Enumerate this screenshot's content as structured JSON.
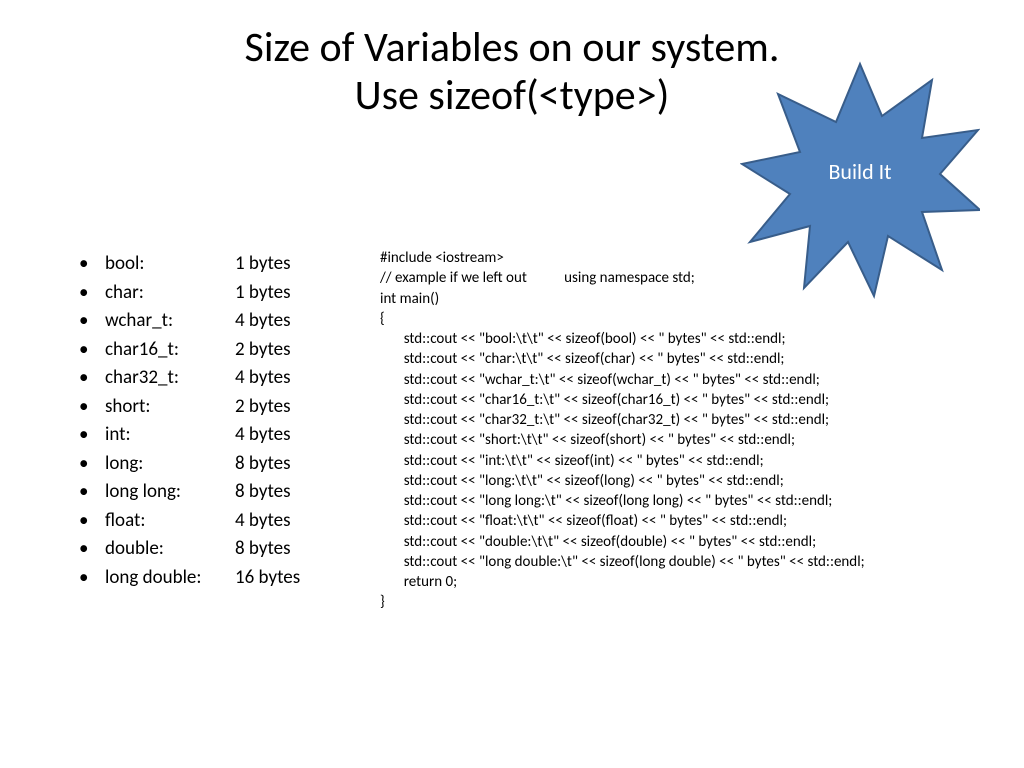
{
  "title": {
    "line1": "Size of Variables on our system.",
    "line2": "Use sizeof(<type>)"
  },
  "badge": {
    "label": "Build It",
    "fill": "#4f81bd",
    "stroke": "#385d8a"
  },
  "sizes": [
    {
      "type": "bool:",
      "value": "1 bytes"
    },
    {
      "type": "char:",
      "value": "1 bytes"
    },
    {
      "type": "wchar_t:",
      "value": "4 bytes"
    },
    {
      "type": "char16_t:",
      "value": "2 bytes"
    },
    {
      "type": "char32_t:",
      "value": "4 bytes"
    },
    {
      "type": "short:",
      "value": "2 bytes"
    },
    {
      "type": "int:",
      "value": "4 bytes"
    },
    {
      "type": "long:",
      "value": "8 bytes"
    },
    {
      "type": "long long:",
      "value": "8 bytes"
    },
    {
      "type": "float:",
      "value": "4 bytes"
    },
    {
      "type": "double:",
      "value": "8 bytes"
    },
    {
      "type": "long double:",
      "value": "16 bytes"
    }
  ],
  "code": "#include <iostream>\n// example if we left out           using namespace std;\nint main()\n{\n       std::cout << \"bool:\\t\\t\" << sizeof(bool) << \" bytes\" << std::endl;\n       std::cout << \"char:\\t\\t\" << sizeof(char) << \" bytes\" << std::endl;\n       std::cout << \"wchar_t:\\t\" << sizeof(wchar_t) << \" bytes\" << std::endl;\n       std::cout << \"char16_t:\\t\" << sizeof(char16_t) << \" bytes\" << std::endl;\n       std::cout << \"char32_t:\\t\" << sizeof(char32_t) << \" bytes\" << std::endl;\n       std::cout << \"short:\\t\\t\" << sizeof(short) << \" bytes\" << std::endl;\n       std::cout << \"int:\\t\\t\" << sizeof(int) << \" bytes\" << std::endl;\n       std::cout << \"long:\\t\\t\" << sizeof(long) << \" bytes\" << std::endl;\n       std::cout << \"long long:\\t\" << sizeof(long long) << \" bytes\" << std::endl;\n       std::cout << \"float:\\t\\t\" << sizeof(float) << \" bytes\" << std::endl;\n       std::cout << \"double:\\t\\t\" << sizeof(double) << \" bytes\" << std::endl;\n       std::cout << \"long double:\\t\" << sizeof(long double) << \" bytes\" << std::endl;\n       return 0;\n}"
}
